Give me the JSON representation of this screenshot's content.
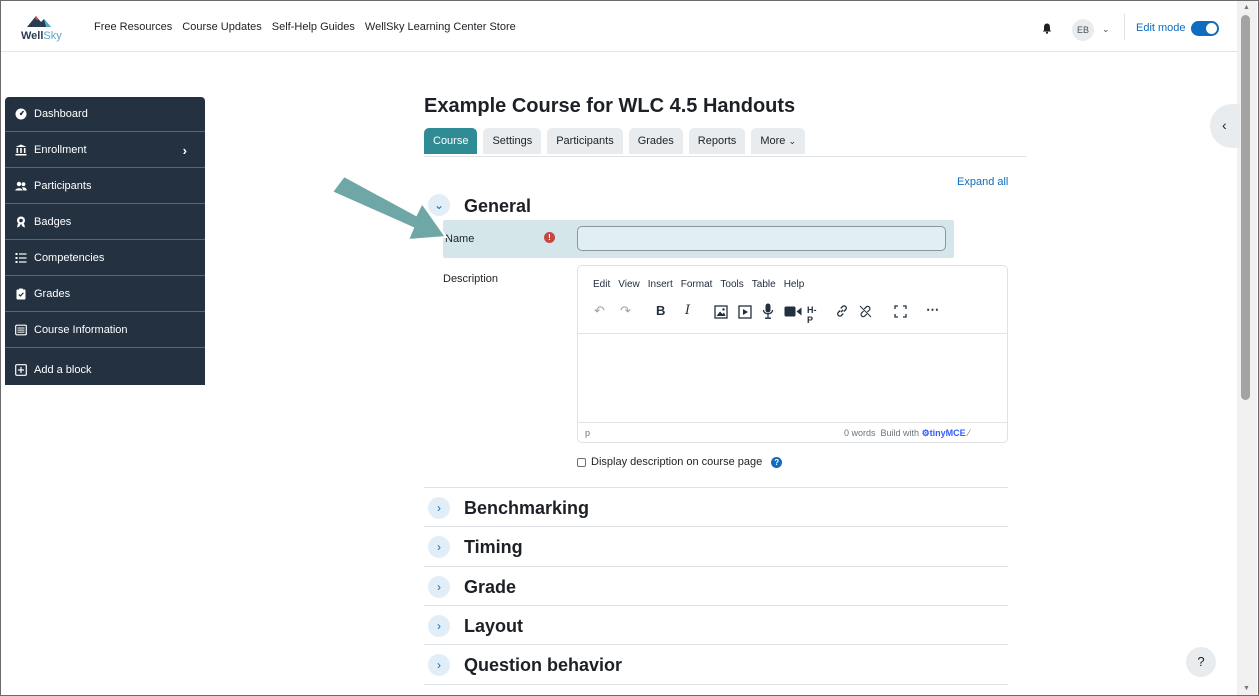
{
  "navbar": {
    "logo_text_a": "Well",
    "logo_text_b": "Sky",
    "links": [
      "Free Resources",
      "Course Updates",
      "Self-Help Guides",
      "WellSky Learning Center Store"
    ],
    "user_initials": "EB",
    "edit_mode_label": "Edit mode",
    "edit_mode_on": true
  },
  "drawer": {
    "items": [
      {
        "label": "Dashboard",
        "icon": "tachometer-icon"
      },
      {
        "label": "Enrollment",
        "icon": "institution-icon"
      },
      {
        "label": "Participants",
        "icon": "users-icon"
      },
      {
        "label": "Badges",
        "icon": "badge-icon"
      },
      {
        "label": "Competencies",
        "icon": "list-icon"
      },
      {
        "label": "Grades",
        "icon": "clipboard-icon"
      },
      {
        "label": "Course Information",
        "icon": "info-panel-icon"
      }
    ],
    "add_block_label": "Add a block"
  },
  "page": {
    "title": "Example Course for WLC 4.5 Handouts",
    "tabs": [
      "Course",
      "Settings",
      "Participants",
      "Grades",
      "Reports",
      "More"
    ],
    "active_tab": "Course",
    "expand_all": "Expand all"
  },
  "form": {
    "general": {
      "title": "General",
      "name_label": "Name",
      "name_value": "",
      "description_label": "Description",
      "editor_menu": [
        "Edit",
        "View",
        "Insert",
        "Format",
        "Tools",
        "Table",
        "Help"
      ],
      "status_path": "p",
      "word_count": "0 words",
      "build_with": "Build with",
      "tiny_brand": "tinyMCE",
      "display_description_label": "Display description on course page"
    },
    "sections": [
      "Benchmarking",
      "Timing",
      "Grade",
      "Layout",
      "Question behavior"
    ]
  },
  "help_button": "?",
  "colors": {
    "drawer_bg": "#243140",
    "active_tab": "#2f8c95",
    "link_blue": "#0f6cbf",
    "highlight": "#d4e6ea",
    "arrow": "#6fa7a7"
  }
}
